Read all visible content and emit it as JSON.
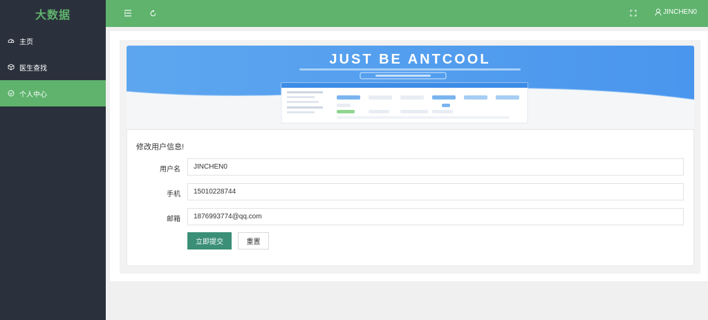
{
  "app": {
    "title": "大数据"
  },
  "sidebar": {
    "items": [
      {
        "label": "主页",
        "icon": "dashboard-icon",
        "active": false
      },
      {
        "label": "医生查找",
        "icon": "cube-icon",
        "active": false
      },
      {
        "label": "个人中心",
        "icon": "check-circle-icon",
        "active": true
      }
    ]
  },
  "header": {
    "user": "JINCHEN0",
    "icons": [
      "menu-toggle-icon",
      "refresh-icon",
      "fullscreen-icon",
      "user-icon"
    ]
  },
  "banner": {
    "headline": "JUST BE ANTCOOL"
  },
  "form": {
    "title": "修改用户信息!",
    "username_label": "用户名",
    "username_value": "JINCHEN0",
    "phone_label": "手机",
    "phone_value": "15010228744",
    "email_label": "邮箱",
    "email_value": "1876993774@qq.com",
    "submit_label": "立即提交",
    "reset_label": "重置"
  },
  "colors": {
    "accent": "#5fb36d",
    "sidebar": "#2b313c",
    "primary_button": "#3a8f76"
  }
}
